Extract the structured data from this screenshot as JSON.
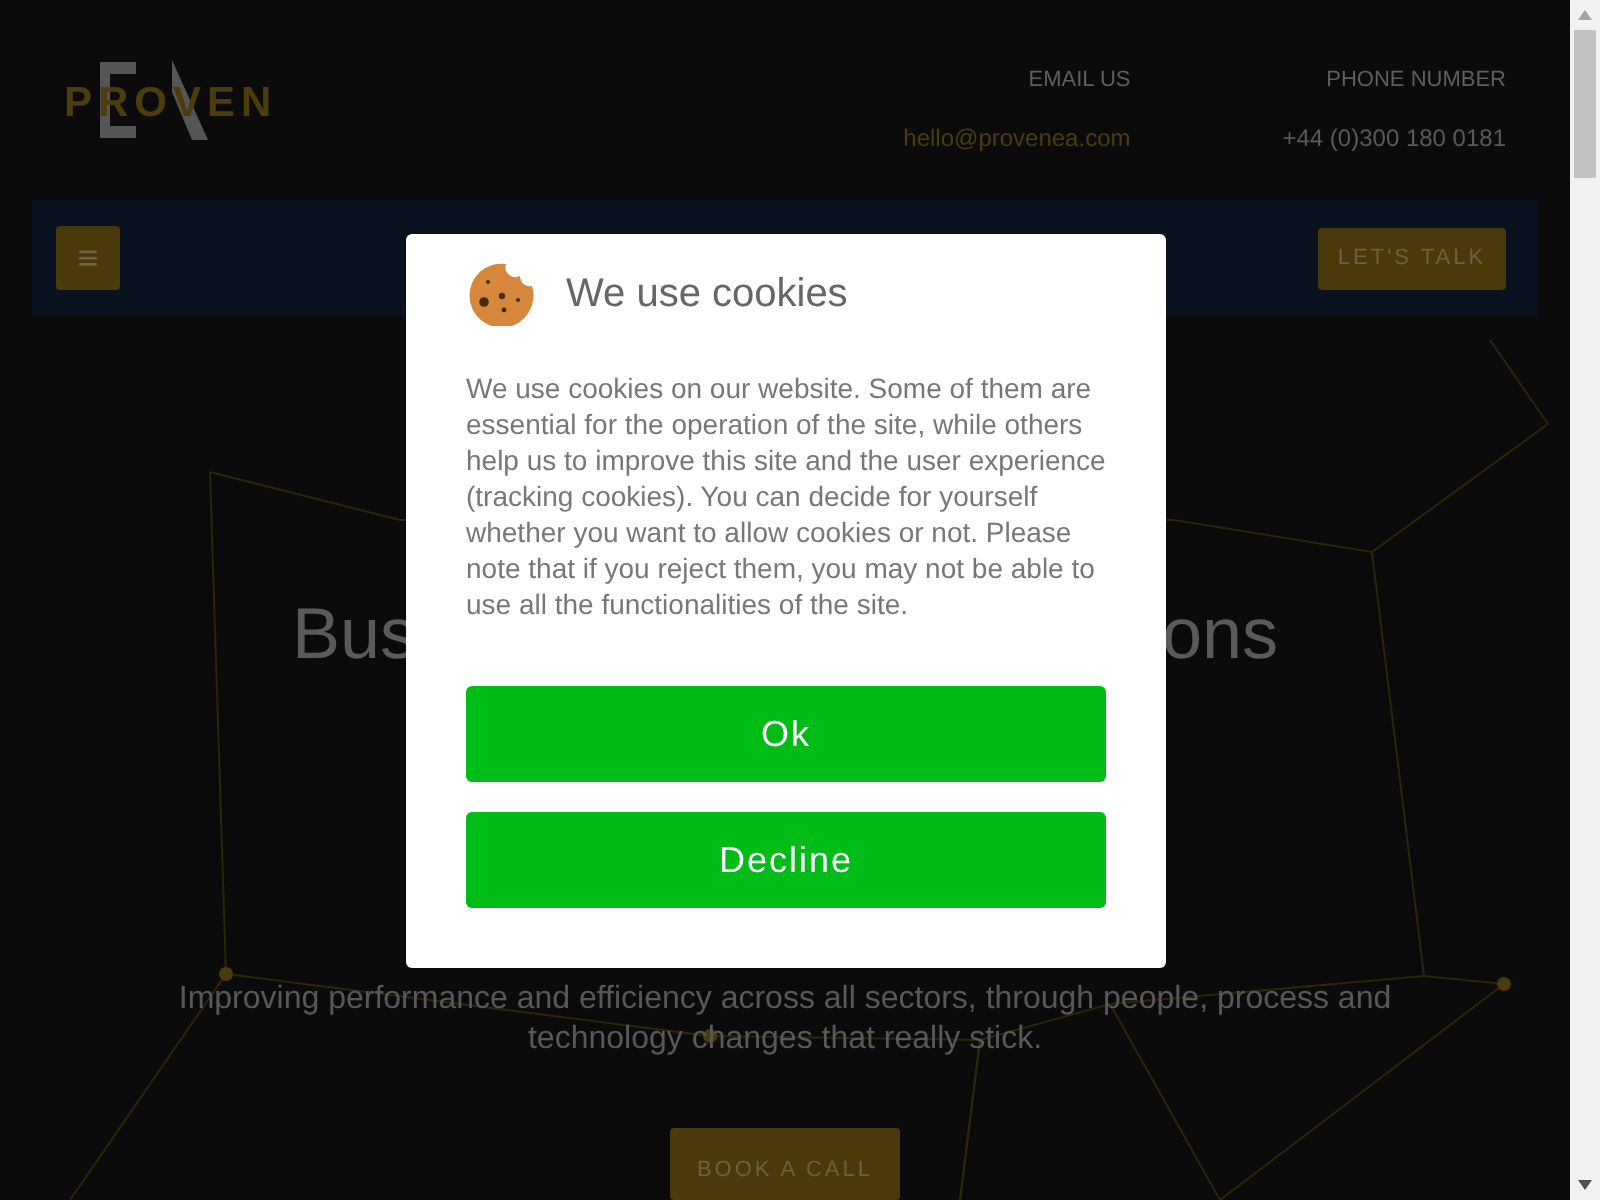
{
  "header": {
    "logo": "PROVEN",
    "contacts": [
      {
        "label": "EMAIL US",
        "value": "hello@provenea.com",
        "kind": "link"
      },
      {
        "label": "PHONE NUMBER",
        "value": "+44 (0)300 180 0181",
        "kind": "text"
      }
    ]
  },
  "nav": {
    "menu_icon": "≡",
    "cta": "LET'S TALK"
  },
  "hero": {
    "heading_parts": [
      "Bus",
      "ons"
    ],
    "subtitle": "Improving performance and efficiency across all sectors, through people, process and technology changes that really stick.",
    "button": "BOOK A CALL"
  },
  "cookie_dialog": {
    "title": "We use cookies",
    "body": "We use cookies on our website. Some of them are essential for the operation of the site, while others help us to improve this site and the user experience (tracking cookies). You can decide for yourself whether you want to allow cookies or not. Please note that if you reject them, you may not be able to use all the functionalities of the site.",
    "buttons": [
      "Ok",
      "Decline"
    ]
  }
}
